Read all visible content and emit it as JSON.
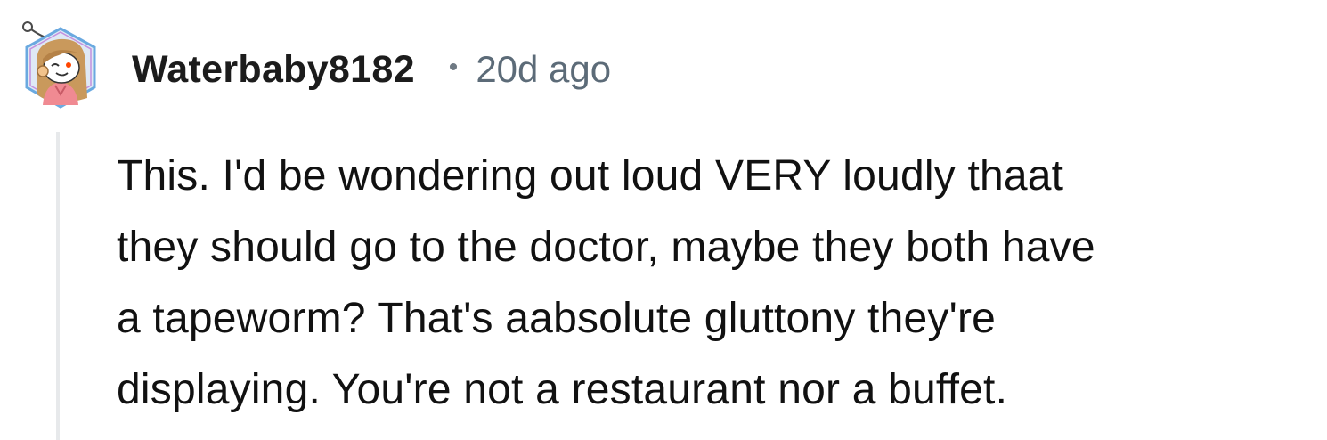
{
  "comment": {
    "author": "Waterbaby8182",
    "separator": "•",
    "timestamp": "20d ago",
    "avatar_icon": "snoo-avatar-icon",
    "body_lines": [
      "This. I'd be wondering out loud VERY loudly thaat",
      "they should go to the doctor, maybe they both have",
      "a tapeworm? That's aabsolute gluttony they're",
      "displaying. You're not a restaurant nor a buffet."
    ]
  },
  "colors": {
    "username": "#1c1c1c",
    "timestamp": "#5c6b78",
    "thread_line": "#e7e9eb",
    "body_text": "#111111"
  }
}
